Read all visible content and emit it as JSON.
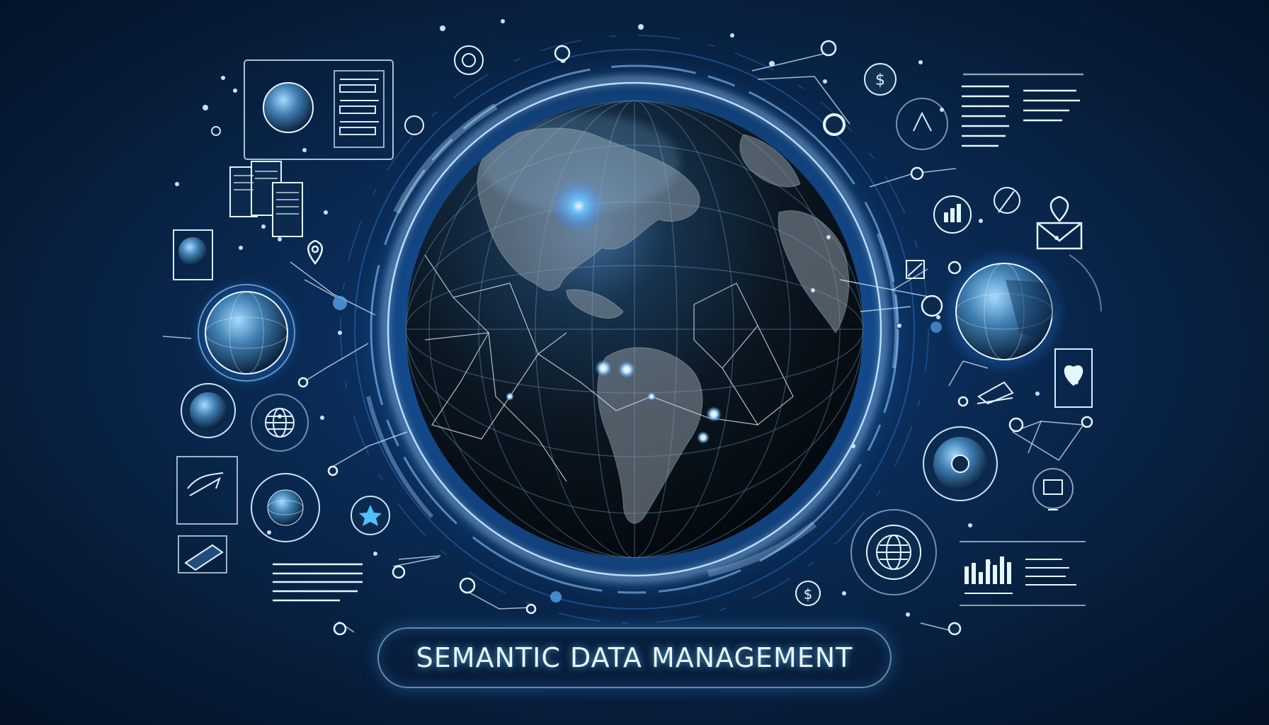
{
  "title": {
    "text": "SEMANTIC DATA MANAGEMENT"
  },
  "colors": {
    "background": "#061a33",
    "glow": "#3fa2ff",
    "accent": "#9ed8ff",
    "line": "#cfe9ff"
  },
  "icons": [
    "globe-icon",
    "network-icon",
    "document-icon",
    "location-pin-icon",
    "mail-pin-icon",
    "bar-chart-icon",
    "heart-icon",
    "star-icon",
    "dollar-icon",
    "disc-icon",
    "monitor-icon",
    "hand-pointer-icon",
    "list-panel-icon",
    "clip-card-icon"
  ]
}
